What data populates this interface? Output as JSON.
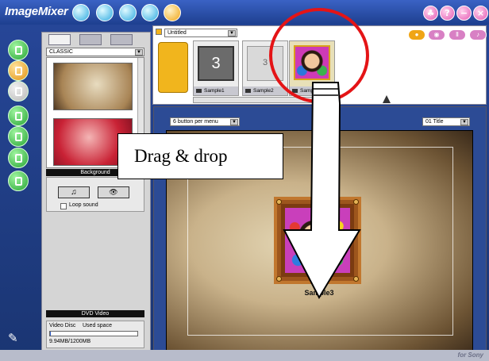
{
  "app": {
    "name": "ImageMixer",
    "footer": "for Sony"
  },
  "project": {
    "title": "Untitled"
  },
  "left_panel": {
    "style_select": "CLASSIC",
    "background_label": "Background",
    "loop_sound_label": "Loop sound",
    "dvd_label": "DVD Video",
    "disc_type": "Video Disc",
    "used_space_label": "Used space",
    "used_space_value": "9.94MB/1200MB",
    "used_space_fraction": 0.0083
  },
  "strip": {
    "items": [
      {
        "label": "Sample1"
      },
      {
        "label": "Sample2"
      },
      {
        "label": "Sample3"
      }
    ]
  },
  "preview": {
    "buttons_per_menu": "6 button per menu",
    "title_select": "01 Title",
    "item_caption": "Sample3"
  },
  "annotation": {
    "text": "Drag & drop"
  },
  "colors": {
    "accent": "#e41416",
    "window_bg": "#1d3a78",
    "nav_green": "#2db33a"
  },
  "icons": [
    "film-icon",
    "music-icon",
    "eye-icon",
    "pause-icon",
    "lock-icon",
    "help-icon",
    "minimize-icon",
    "close-icon"
  ]
}
